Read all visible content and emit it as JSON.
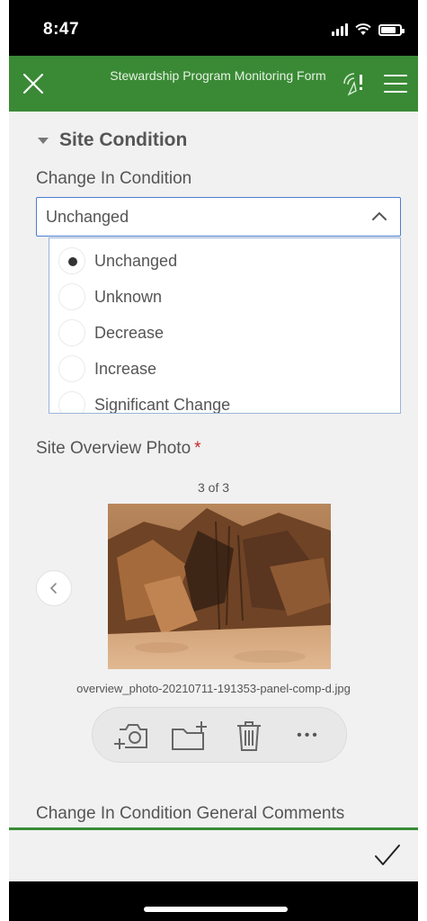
{
  "status_bar": {
    "time": "8:47"
  },
  "header": {
    "title": "Stewardship Program Monitoring Form"
  },
  "section": {
    "title": "Site Condition"
  },
  "change_in_condition": {
    "label": "Change In Condition",
    "selected": "Unchanged",
    "options": [
      "Unchanged",
      "Unknown",
      "Decrease",
      "Increase",
      "Significant Change"
    ]
  },
  "photo_field": {
    "label": "Site Overview Photo",
    "required_mark": "*",
    "counter": "3 of 3",
    "filename": "overview_photo-20210711-191353-panel-comp-d.jpg"
  },
  "toolbar": {
    "more_label": "•••"
  },
  "comments": {
    "label": "Change In Condition General Comments"
  },
  "colors": {
    "accent": "#3a8a35",
    "focus": "#4a7fd0",
    "required": "#c62828"
  }
}
